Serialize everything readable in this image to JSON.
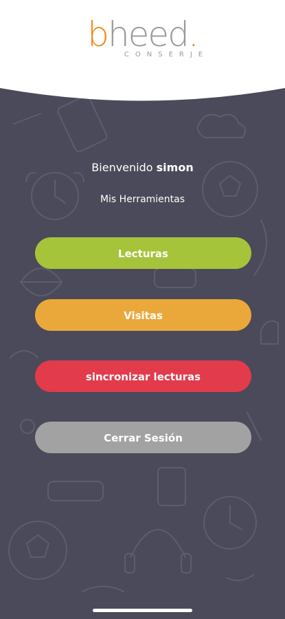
{
  "header": {
    "logo_prefix": "b",
    "logo_rest": "heed",
    "logo_dot": ".",
    "logo_sub": "CONSERJE",
    "accent": "#f28c1a"
  },
  "welcome": {
    "prefix": "Bienvenido",
    "user": "simon"
  },
  "subtitle": "Mis Herramientas",
  "buttons": {
    "lecturas": {
      "label": "Lecturas",
      "color": "#a6c43a"
    },
    "visitas": {
      "label": "Visitas",
      "color": "#eba83a"
    },
    "sincronizar": {
      "label": "sincronizar lecturas",
      "color": "#e23b4b"
    },
    "cerrar": {
      "label": "Cerrar Sesión",
      "color": "#a2a2a2"
    }
  },
  "background_color": "#4a4a5a"
}
